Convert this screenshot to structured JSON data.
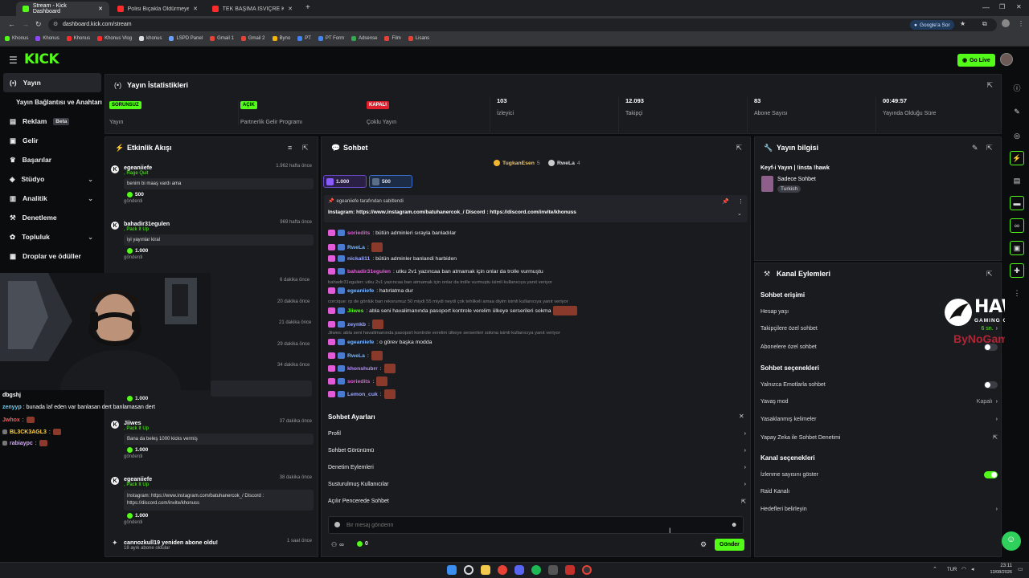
{
  "browser": {
    "tabs": [
      {
        "title": "Stream - Kick Dashboard",
        "active": true
      },
      {
        "title": "Polisi Bıçakla Öldürmeye Çalıştı",
        "active": false
      },
      {
        "title": "TEK BAŞIMA İSVİÇRE KÖYLERİNE",
        "active": false
      }
    ],
    "url": "dashboard.kick.com/stream",
    "google_btn": "Google'a Sor",
    "bookmarks": [
      "Khonus",
      "Khonus",
      "Khonus",
      "Khonus Vlog",
      "khonus",
      "LSPD Panel",
      "Gmail 1",
      "Gmail 2",
      "Byno",
      "PT",
      "PT Form",
      "Adsense",
      "Film",
      "Lisans"
    ]
  },
  "header": {
    "logo": "KICK",
    "go_live": "Go Live"
  },
  "sidebar": {
    "items": [
      {
        "label": "Yayın",
        "icon": "broadcast-icon",
        "active": true
      },
      {
        "label": "Yayın Bağlantısı ve Anahtarı",
        "icon": "",
        "active": false
      },
      {
        "label": "Reklam",
        "icon": "ad-icon",
        "badge": "Beta"
      },
      {
        "label": "Gelir",
        "icon": "wallet-icon"
      },
      {
        "label": "Başarılar",
        "icon": "trophy-icon"
      },
      {
        "label": "Stüdyo",
        "icon": "studio-icon",
        "chevron": true
      },
      {
        "label": "Analitik",
        "icon": "analytics-icon",
        "chevron": true
      },
      {
        "label": "Denetleme",
        "icon": "hammer-icon"
      },
      {
        "label": "Topluluk",
        "icon": "community-icon",
        "chevron": true
      },
      {
        "label": "Droplar ve ödüller",
        "icon": "gift-icon"
      }
    ]
  },
  "stats": {
    "title": "Yayın İstatistikleri",
    "cells": [
      {
        "badge": "SORUNSUZ",
        "label": "Yayın"
      },
      {
        "badge": "AÇIK",
        "label": "Partnerlik Gelir Programı"
      },
      {
        "badge": "KAPALI",
        "label": "Çoklu Yayın"
      },
      {
        "value": "103",
        "label": "İzleyici"
      },
      {
        "value": "12.093",
        "label": "Takipçi"
      },
      {
        "value": "83",
        "label": "Abone Sayısı"
      },
      {
        "value": "00:49:57",
        "label": "Yayında Olduğu Süre"
      }
    ]
  },
  "activity": {
    "title": "Etkinlik Akışı",
    "items": [
      {
        "user": "egeaniiefe",
        "sub": "Rage Quit",
        "time": "1.962 hafta önce",
        "msg": "benim bi maaş vardı ama",
        "amount": "500",
        "sent": "gönderdi"
      },
      {
        "user": "bahadir31egulen",
        "sub": "Pack It Up",
        "time": "969 hafta önce",
        "msg": "iyi yayınlar kiral",
        "amount": "1.000",
        "sent": "gönderdi"
      },
      {
        "time": "6 dakika önce"
      },
      {
        "time": "20 dakika önce"
      },
      {
        "time": "21 dakika önce"
      },
      {
        "time": "29 dakika önce"
      },
      {
        "time": "34 dakika önce",
        "amount": "1.000"
      },
      {
        "user": "Jiiwes",
        "sub": "Pack It Up",
        "time": "37 dakika önce",
        "msg": "Bana da beleş 1000 kicks vermiş",
        "amount": "1.000",
        "sent": "gönderdi"
      },
      {
        "user": "egeaniiefe",
        "sub": "Pack It Up",
        "time": "38 dakika önce",
        "msg": "Instagram: https://www.instagram.com/batuhanercok_/ Discord : https://discord.com/invite/khonuss",
        "amount": "1.000",
        "sent": "gönderdi"
      },
      {
        "user": "cannozkull19 yeniden abone oldu!",
        "sub": "18 ayık abone oldular",
        "time": "1 saat önce"
      }
    ],
    "overlay_chat": [
      {
        "user": "dbgshj",
        "text": ""
      },
      {
        "user": "zenyyp",
        "text": ": bunada laf eden var banlasan dert banlamasan dert"
      },
      {
        "user": "Jwhox",
        "text": ":"
      },
      {
        "user": "BL3CK3AGL3",
        "text": ":"
      },
      {
        "user": "rabiaypc",
        "text": ":"
      }
    ]
  },
  "chat": {
    "title": "Sohbet",
    "top_users": [
      {
        "name": "TugkanEsen",
        "count": "5"
      },
      {
        "name": "RweLa",
        "count": "4"
      }
    ],
    "goal_chips": [
      "1.000",
      "500"
    ],
    "pinned_by": "egeaniiefe tarafından sabitlendi",
    "pinned_text": "Instagram: https://www.instagram.com/batuhanercok_/ Discord : https://discord.com/invite/khonuss",
    "messages": [
      {
        "user": "soriedits",
        "text": ": bütün adminleri sırayla banladılar",
        "color": "#e45bd9"
      },
      {
        "user": "RweLa",
        "text": ":",
        "color": "#74b3ff"
      },
      {
        "user": "nickali11",
        "text": ": bütün adminler banlandi harbiden",
        "color": "#9aa7ff"
      },
      {
        "user": "bahadir31egulen",
        "text": ": utku 2v1 yazıncaa ban atmamak için onlar da trolle vurmuştu",
        "color": "#e45bd9"
      },
      {
        "sys": "bahadir31egulen: utku 2v1 yazıncaa ban atmamak için onlar da trolle vurmuştu isimli kullanıcıya yanıt veriyor"
      },
      {
        "user": "egeaniiefe",
        "text": ": hatırlatma dur",
        "color": "#7ab6ff"
      },
      {
        "sys": "corcique: rp de gönlük ban rekorumuz 50 miydi 55 miydi neydi çok tehlikeli amaa diyim isimli kullanıcıya yanıt veriyor"
      },
      {
        "user": "Jiiwes",
        "text": ": abla seni havalimanında pasoport kontrole verelim ülkeye serserileri sokma",
        "color": "#53fc18"
      },
      {
        "user": "zeynkb",
        "text": ":",
        "color": "#9aa7ff"
      },
      {
        "sys": "Jiiwes: abla seni havalimanında pasoport kontrole verelim ülkeye serserileri sokma isimli kullanıcıya yanıt veriyor"
      },
      {
        "user": "egeaniiefe",
        "text": ": o görev başka modda",
        "color": "#7ab6ff"
      },
      {
        "user": "RweLa",
        "text": ":",
        "color": "#74b3ff"
      },
      {
        "user": "khonshubrr",
        "text": ":",
        "color": "#b98cff"
      },
      {
        "user": "soriedits",
        "text": ":",
        "color": "#e45bd9"
      },
      {
        "user": "Lemon_cuk",
        "text": ":",
        "color": "#9aa7ff"
      }
    ],
    "settings": {
      "title": "Sohbet Ayarları",
      "rows": [
        "Profil",
        "Sohbet Görünümü",
        "Denetim Eylemleri",
        "Susturulmuş Kullanıcılar",
        "Açılır Pencerede Sohbet"
      ]
    },
    "input_placeholder": "Bir mesaj gönderin",
    "points": "0",
    "send": "Gönder"
  },
  "stream_info": {
    "title": "Yayın bilgisi",
    "stream_title": "Keyf-i Yayın | !insta !hawk",
    "category": "Sadece Sohbet",
    "tag": "Turkish"
  },
  "channel_actions": {
    "title": "Kanal Eylemleri",
    "chat_access_title": "Sohbet erişimi",
    "chat_access": [
      {
        "label": "Hesap yaşı",
        "value": ""
      },
      {
        "label": "Takipçilere özel sohbet",
        "value": "6 sn."
      },
      {
        "label": "Abonelere özel sohbet",
        "toggle": false
      }
    ],
    "chat_options_title": "Sohbet seçenekleri",
    "chat_options": [
      {
        "label": "Yalnızca Emotlarla sohbet",
        "toggle": false
      },
      {
        "label": "Yavaş mod",
        "value": "Kapalı"
      },
      {
        "label": "Yasaklanmış kelimeler",
        "value": ""
      },
      {
        "label": "Yapay Zeka ile Sohbet Denetimi",
        "value": ""
      }
    ],
    "channel_options_title": "Kanal seçenekleri",
    "channel_options": [
      {
        "label": "İzlenme sayısını göster",
        "toggle": true
      },
      {
        "label": "Raid Kanalı",
        "value": ""
      },
      {
        "label": "Hedefleri belirleyin",
        "value": ""
      }
    ]
  },
  "watermark": {
    "brand": "HAWK",
    "sub": "GAMING CHAIR",
    "by": "ByNoGame"
  },
  "taskbar": {
    "lang": "TUR",
    "time": "23:11",
    "date": "13/08/2026"
  },
  "colors": {
    "accent": "#53fc18",
    "bg": "#0b0c0e",
    "panel": "#191b1f"
  }
}
